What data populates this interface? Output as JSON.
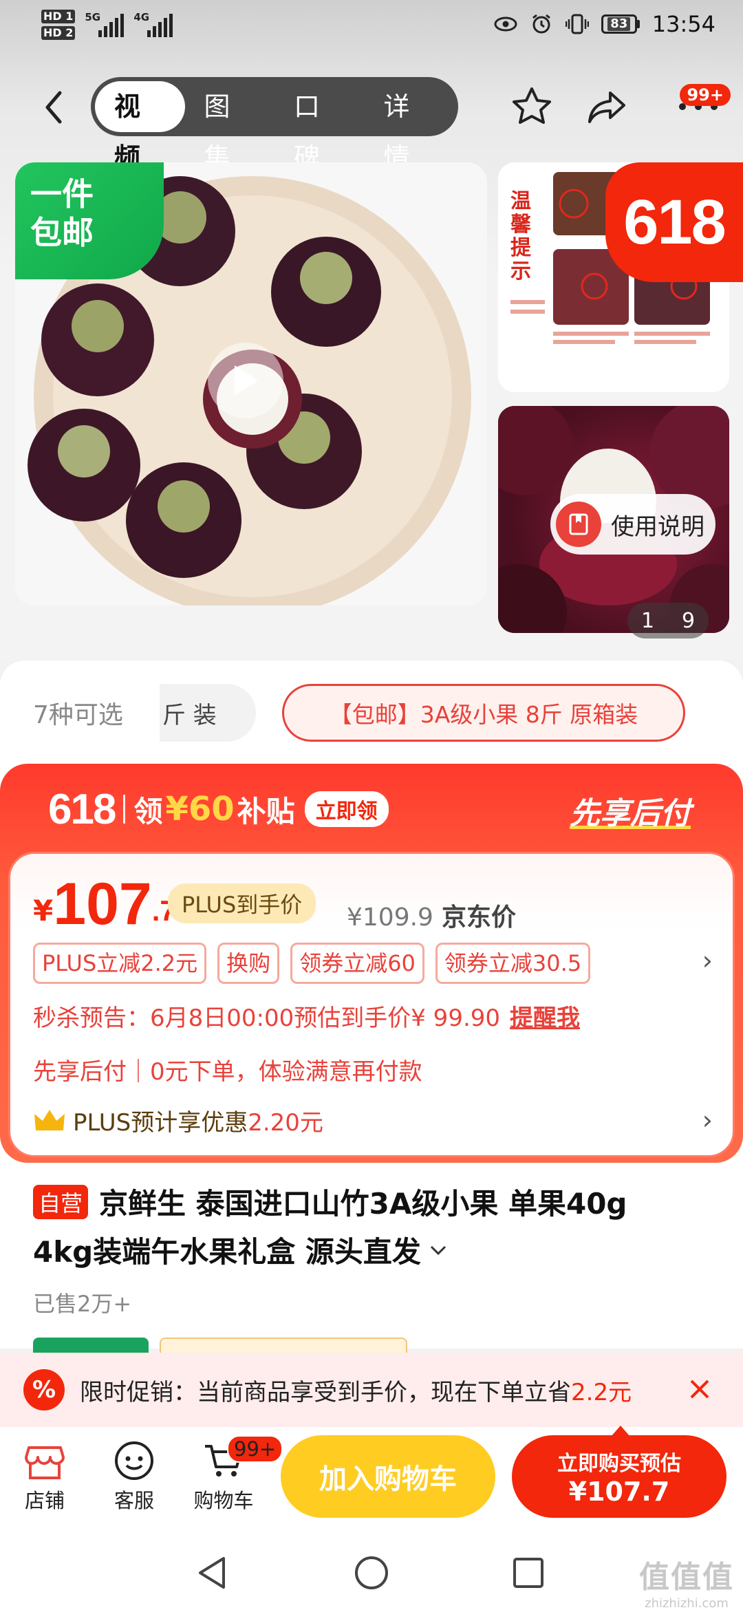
{
  "status_bar": {
    "hd1": "HD 1",
    "hd2": "HD 2",
    "net1": "5G",
    "net2": "4G",
    "battery": "83",
    "time": "13:54"
  },
  "nav": {
    "tabs": [
      "视频",
      "图集",
      "口碑",
      "详情"
    ],
    "more_badge": "99+"
  },
  "gallery": {
    "free_ship_l1": "一件",
    "free_ship_l2": "包邮",
    "warm_tip": "温馨提示",
    "badge_618": "618",
    "usage_label": "使用说明",
    "page_current": "1",
    "page_total": "9"
  },
  "specs": {
    "count": "7种可选",
    "chip1": "斤 装",
    "chip2": "【包邮】3A级小果 8斤  原箱装"
  },
  "promo": {
    "p618": "618",
    "claim": "领",
    "amount": "¥60",
    "subsidy": "补贴",
    "button": "立即领",
    "pay_later": "先享后付"
  },
  "price": {
    "currency": "¥",
    "int": "107",
    "dec": ".7",
    "plus_tag": "PLUS到手价",
    "jd_value": "¥109.9",
    "jd_label": "京东价"
  },
  "coupons": [
    "PLUS立减2.2元",
    "换购",
    "领券立减60",
    "领券立减30.5"
  ],
  "flash": {
    "text": "秒杀预告：6月8日00:00预估到手价¥ 99.90",
    "remind": "提醒我"
  },
  "pay_later_line": "先享后付｜0元下单，体验满意再付款",
  "plus_benefit": {
    "text": "PLUS预计享优惠",
    "value": "2.20元"
  },
  "product": {
    "self_tag": "自营",
    "title_l1": "京鲜生 泰国进口山竹3A级小果 单果40g",
    "title_l2": "4kg装端午水果礼盒  源头直发",
    "sold": "已售2万+"
  },
  "limit_bar": {
    "icon": "%",
    "text": "限时促销：当前商品享受到手价，现在下单立省",
    "save": "2.2元"
  },
  "action_bar": {
    "shop": "店铺",
    "service": "客服",
    "cart": "购物车",
    "cart_badge": "99+",
    "add_cart": "加入购物车",
    "buy_l1": "立即购买预估",
    "buy_l2": "¥107.7"
  },
  "watermark": {
    "main": "值值值",
    "sub": "zhizhizhi.com"
  },
  "colors": {
    "brand_red": "#f2270c",
    "plus_gold": "#fde9b6",
    "add_cart_yellow": "#ffcc22",
    "free_ship_green": "#22c55e"
  }
}
